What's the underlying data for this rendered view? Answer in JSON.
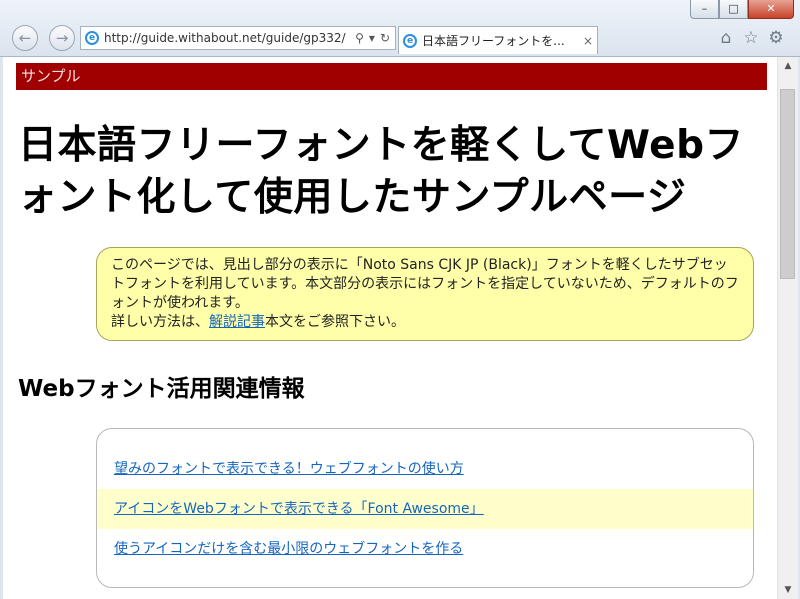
{
  "browser": {
    "address_url": "http://guide.withabout.net/guide/gp332/",
    "tab_title": "日本語フリーフォントを...",
    "tab_close": "×",
    "search_glyph": "⚲",
    "dropdown_glyph": "▾",
    "refresh_glyph": "↻",
    "back_glyph": "←",
    "forward_glyph": "→",
    "home_glyph": "⌂",
    "favorites_glyph": "☆",
    "settings_glyph": "⚙",
    "minimize_glyph": "–",
    "maximize_glyph": "□",
    "close_glyph": "✕",
    "ie_glyph": "e"
  },
  "page": {
    "banner": "サンプル",
    "title": "日本語フリーフォントを軽くしてWebフォント化して使用したサンプルページ",
    "note": {
      "line1": "このページでは、見出し部分の表示に「Noto Sans CJK JP (Black)」フォントを軽くしたサブセットフォントを利用しています。本文部分の表示にはフォントを指定していないため、デフォルトのフォントが使われます。",
      "line2_prefix": "詳しい方法は、",
      "line2_link": "解説記事",
      "line2_suffix": "本文をご参照下さい。"
    },
    "section_heading": "Webフォント活用関連情報",
    "links": [
      "望みのフォントで表示できる！ウェブフォントの使い方",
      "アイコンをWebフォントで表示できる「Font Awesome」",
      "使うアイコンだけを含む最小限のウェブフォントを作る"
    ]
  },
  "scrollbar": {
    "up_glyph": "▲",
    "down_glyph": "▼"
  },
  "colors": {
    "banner_bg": "#a00000",
    "note_bg": "#ffffaa",
    "link": "#1565c0",
    "alt_row": "#ffffcc"
  }
}
